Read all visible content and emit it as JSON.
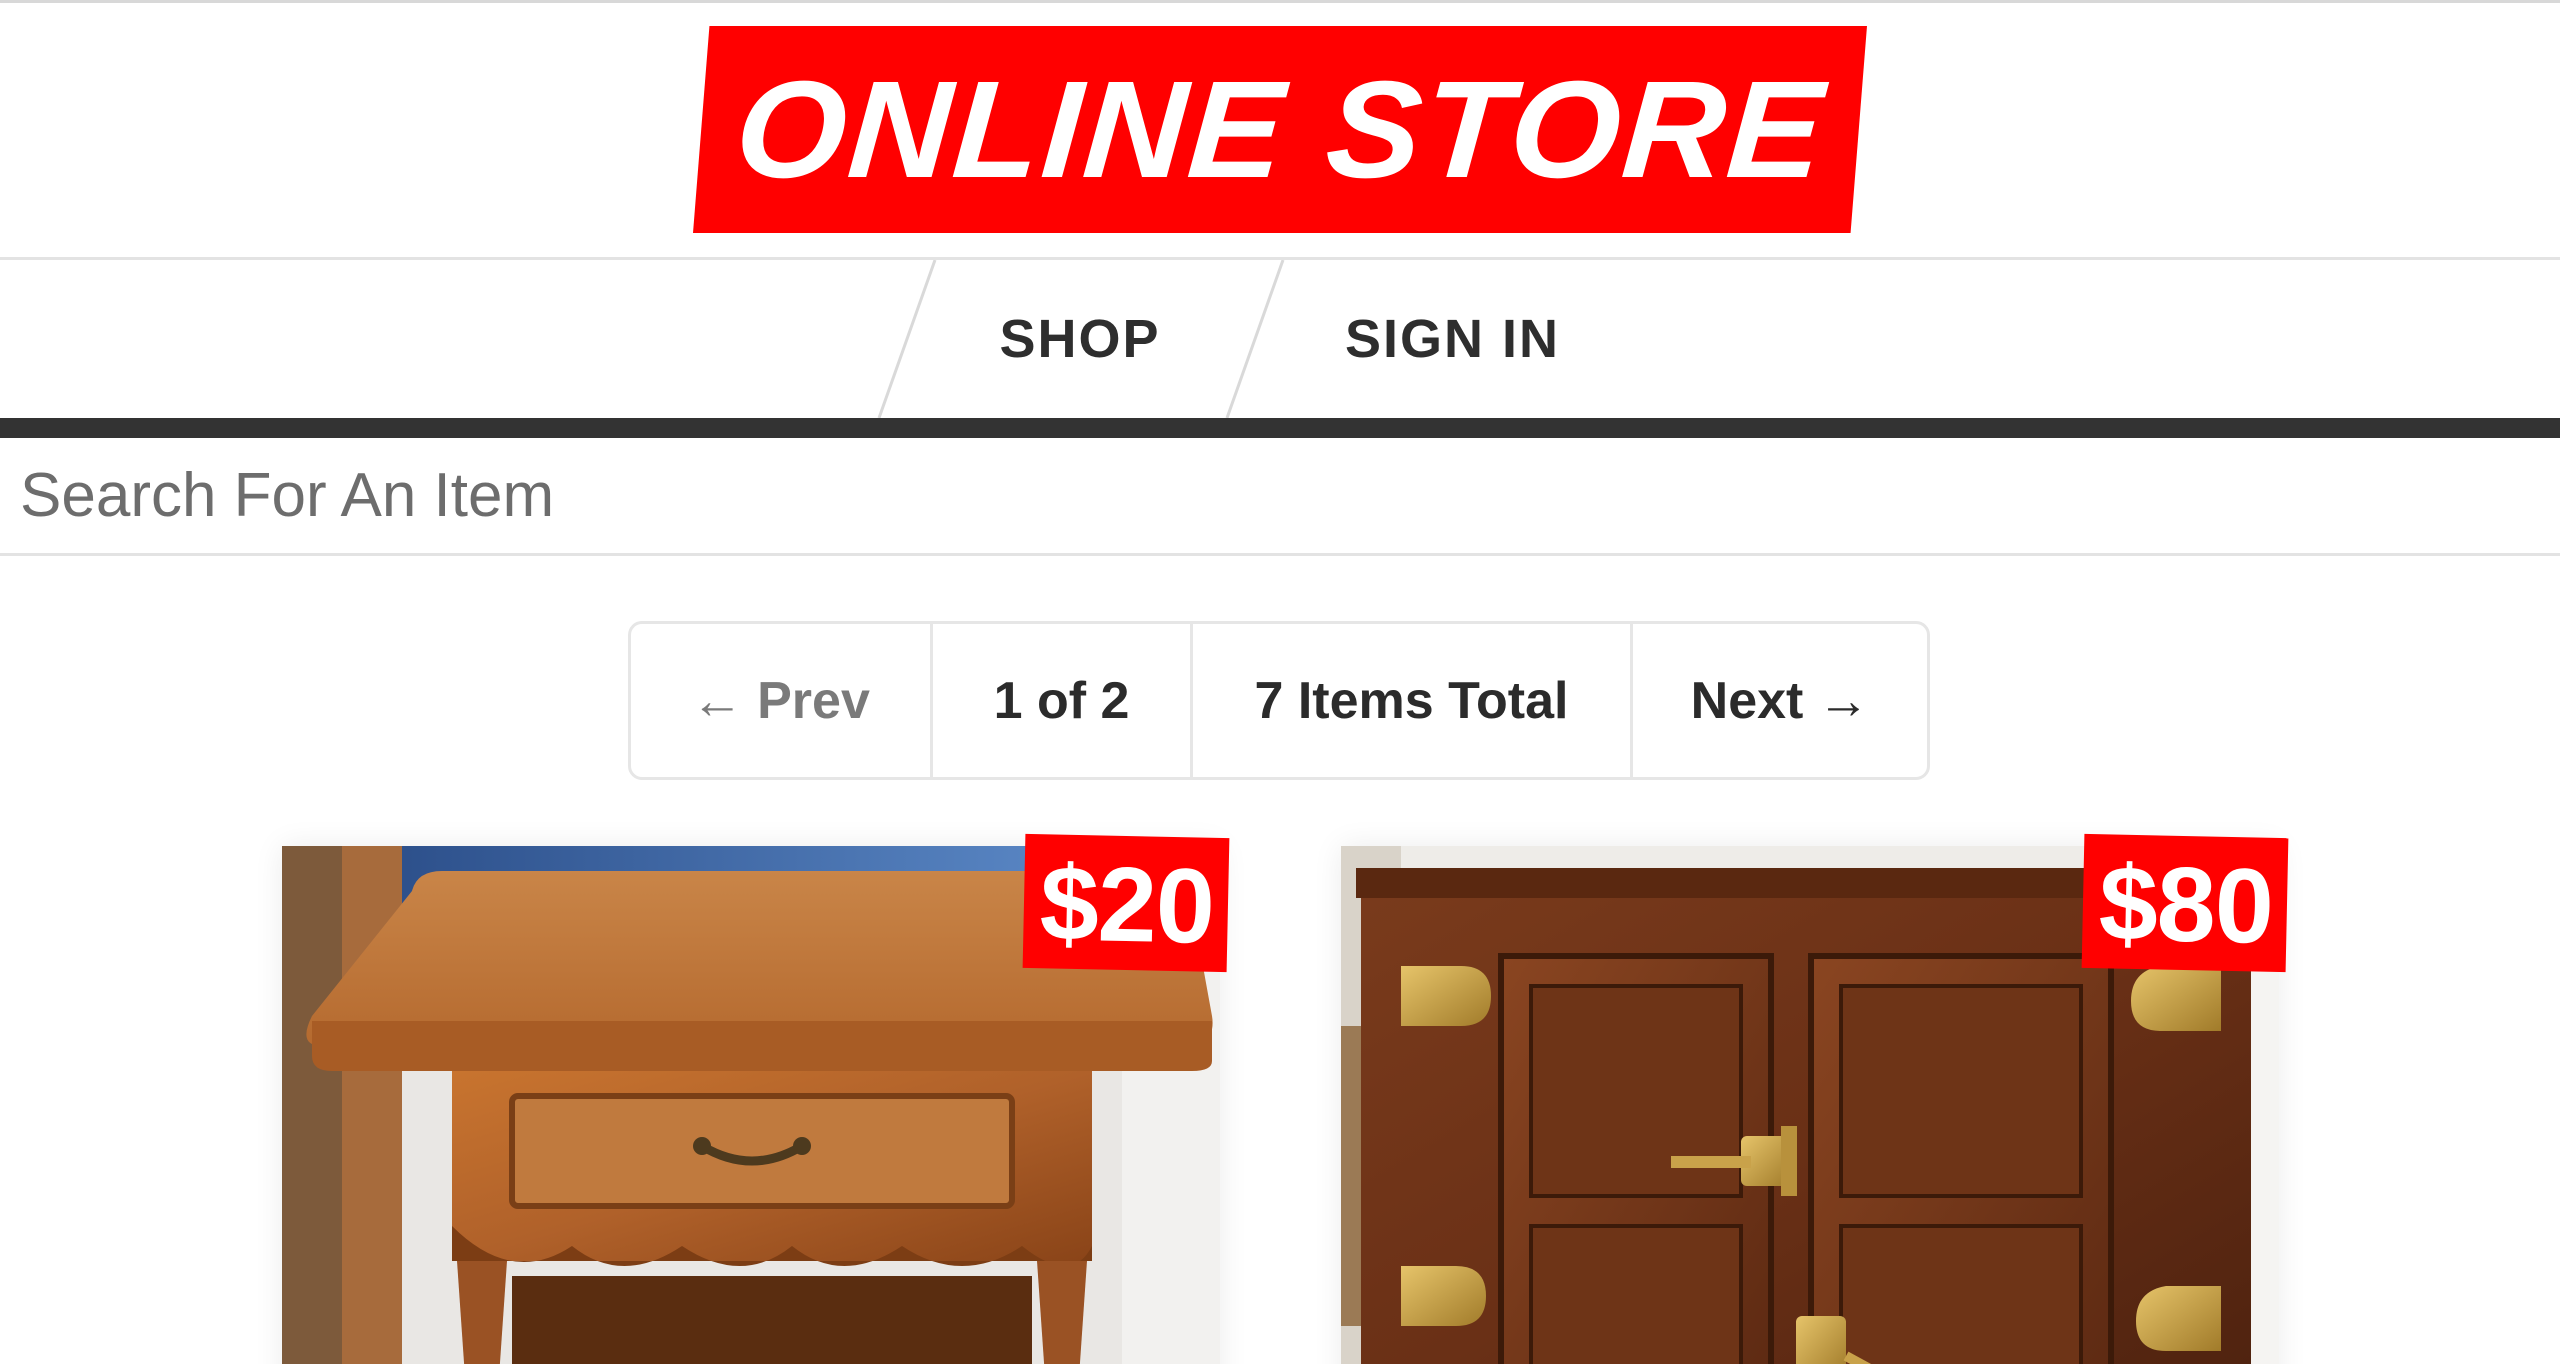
{
  "brand": {
    "logo_text": "ONLINE STORE",
    "logo_color": "#ff0000"
  },
  "nav": {
    "items": [
      {
        "label": "SHOP"
      },
      {
        "label": "SIGN IN"
      }
    ]
  },
  "search": {
    "placeholder": "Search For An Item",
    "value": ""
  },
  "pagination": {
    "prev_arrow": "←",
    "prev_label": "Prev",
    "page_indicator": "1 of 2",
    "total_label": "7 Items Total",
    "next_label": "Next",
    "next_arrow": "→"
  },
  "products": [
    {
      "price": "$20",
      "image_subject": "wooden end table with drawer"
    },
    {
      "price": "$80",
      "image_subject": "antique oak icebox cabinet with brass hinges"
    }
  ],
  "colors": {
    "accent": "#ff0000",
    "nav_bar": "#333333",
    "text_dark": "#2e2e2e",
    "text_muted": "#7a7a7a"
  }
}
